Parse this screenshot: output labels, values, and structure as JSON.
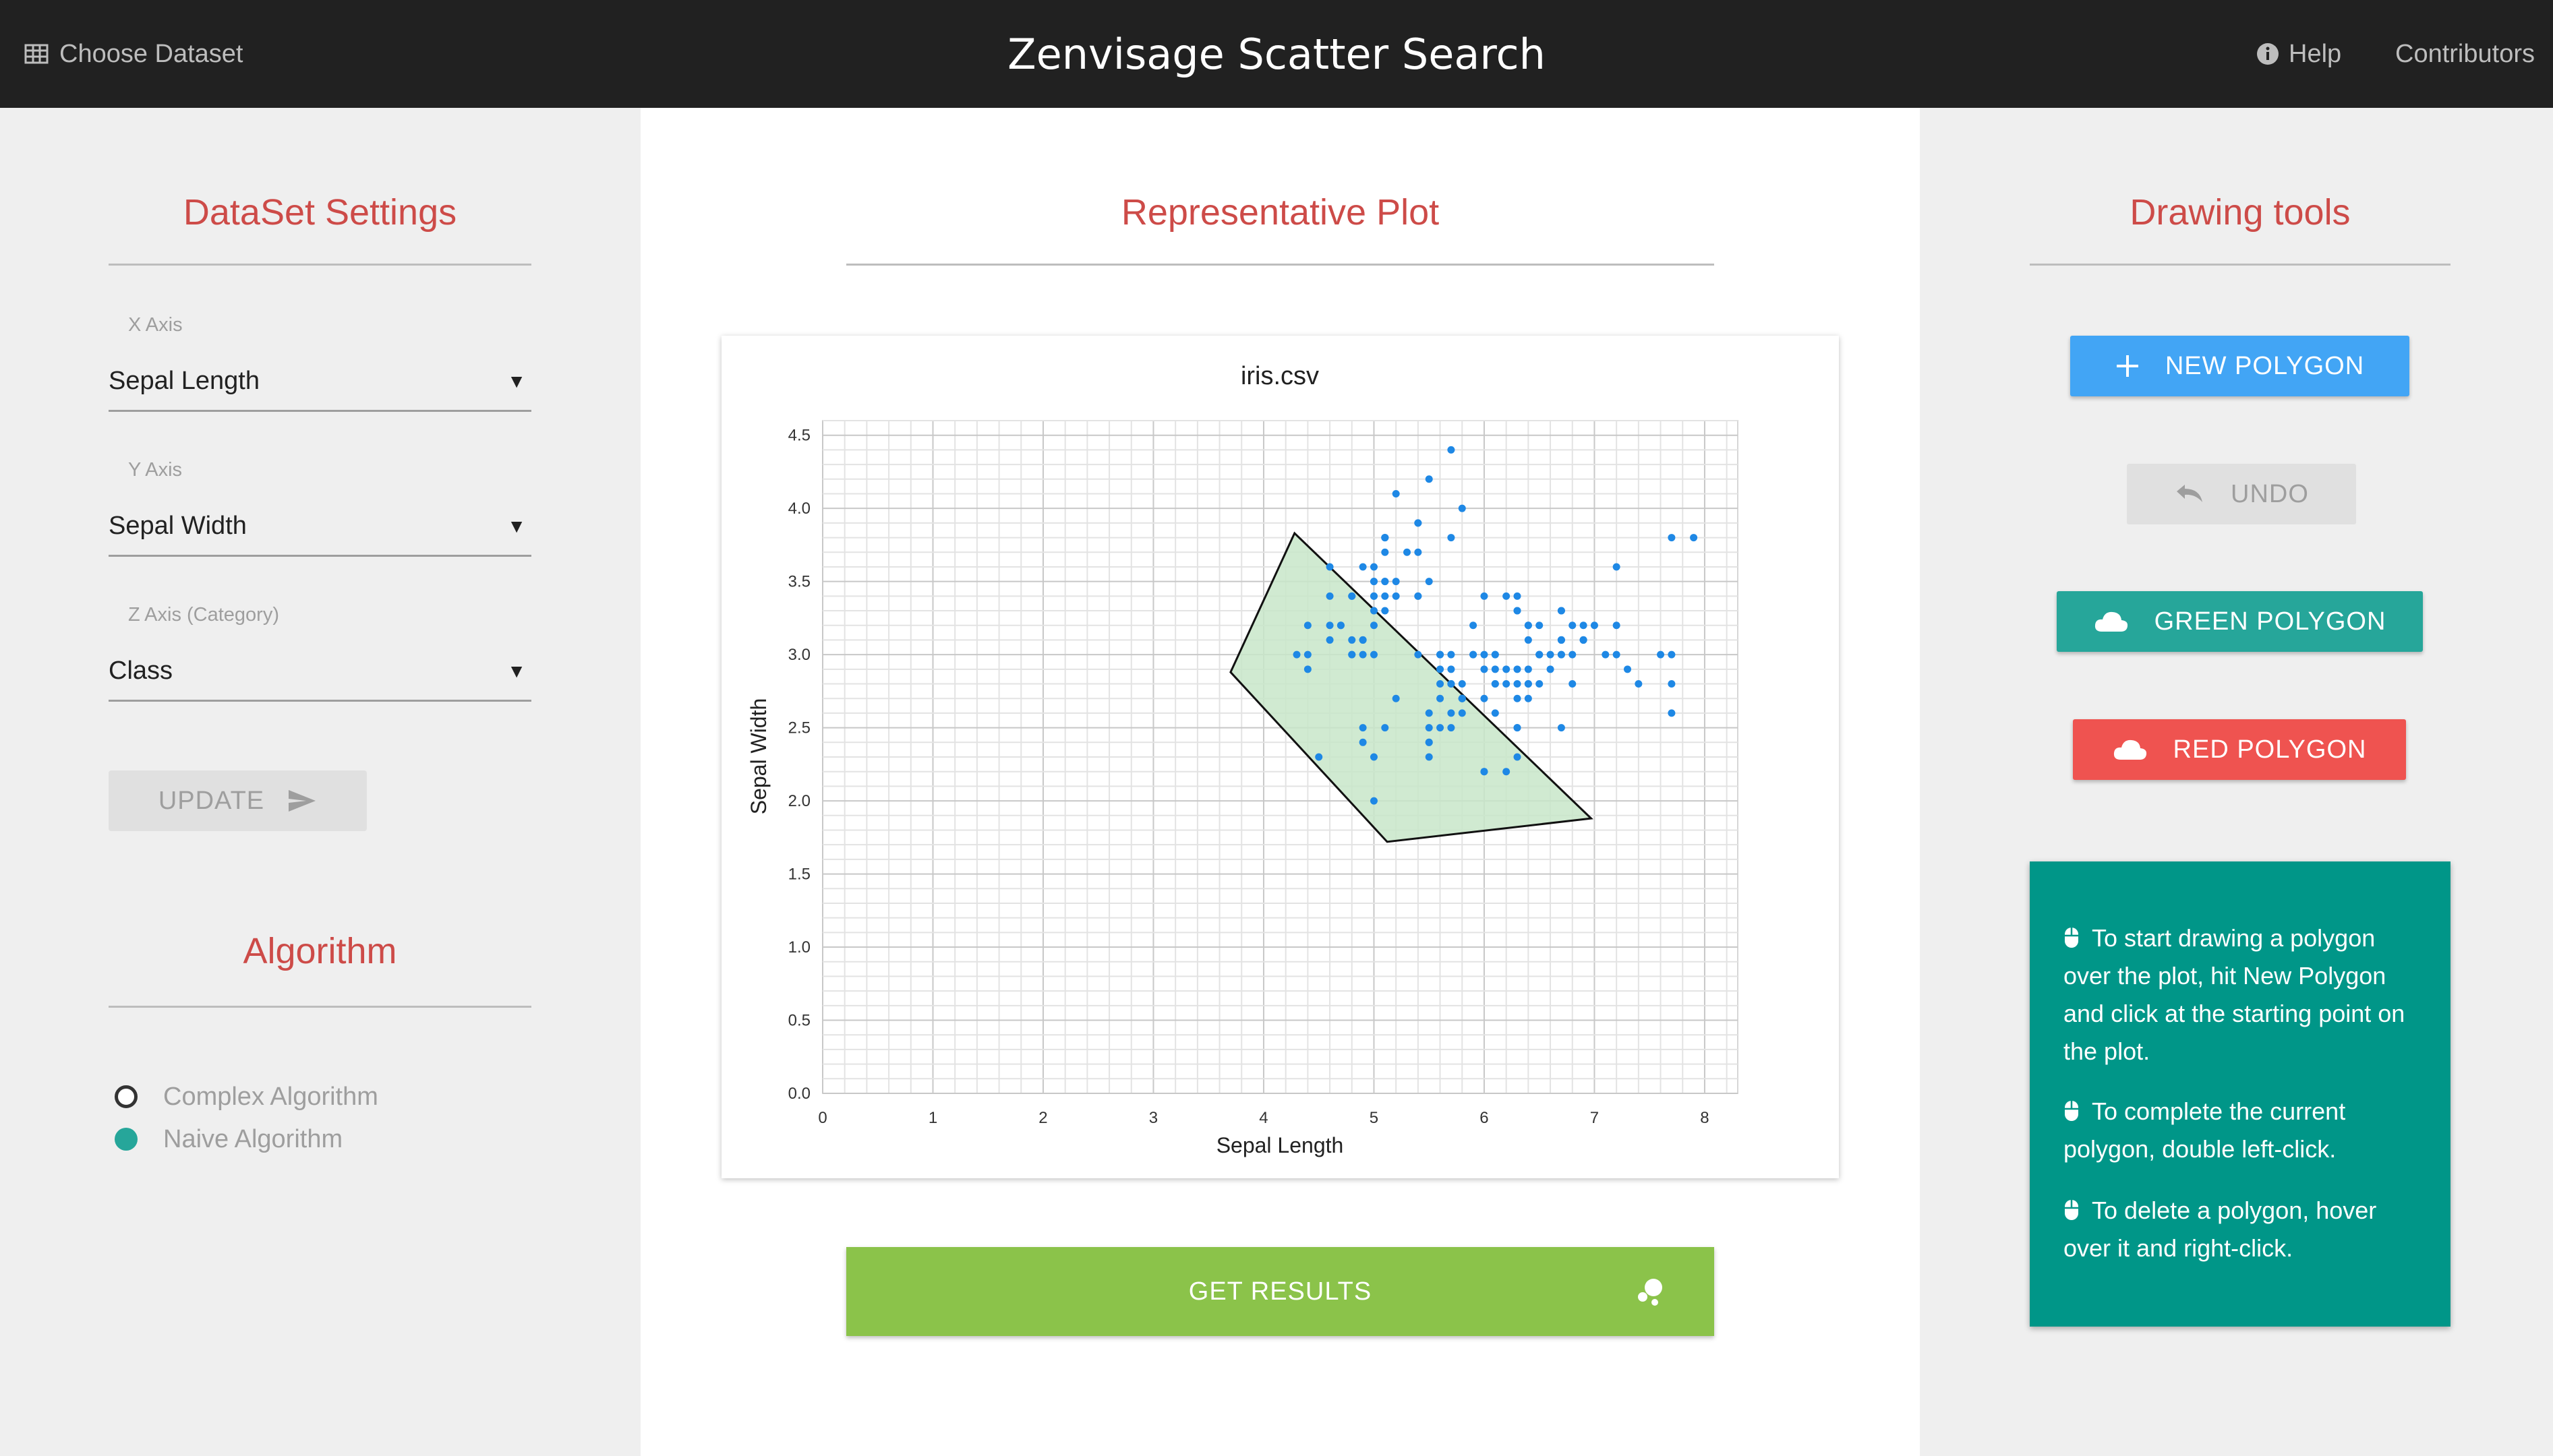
{
  "topbar": {
    "choose_dataset": "Choose Dataset",
    "title": "Zenvisage Scatter Search",
    "help": "Help",
    "contributors": "Contributors"
  },
  "dataset_settings": {
    "heading": "DataSet Settings",
    "x_axis_label": "X Axis",
    "x_axis_value": "Sepal Length",
    "y_axis_label": "Y Axis",
    "y_axis_value": "Sepal Width",
    "z_axis_label": "Z Axis (Category)",
    "z_axis_value": "Class",
    "update_label": "UPDATE"
  },
  "algorithm": {
    "heading": "Algorithm",
    "options": [
      {
        "label": "Complex Algorithm",
        "selected": false
      },
      {
        "label": "Naive Algorithm",
        "selected": true
      }
    ]
  },
  "center": {
    "heading": "Representative Plot",
    "get_results_label": "GET RESULTS"
  },
  "drawing_tools": {
    "heading": "Drawing tools",
    "new_polygon": "NEW POLYGON",
    "undo": "UNDO",
    "green_polygon": "GREEN POLYGON",
    "red_polygon": "RED POLYGON",
    "help": [
      "To start drawing a polygon over the plot, hit New Polygon and click at the starting point on the plot.",
      "To complete the current polygon, double left-click.",
      "To delete a polygon, hover over it and right-click."
    ]
  },
  "colors": {
    "heading": "#cd4b48",
    "topbar": "#212121",
    "point": "#1e88e5",
    "polygon_fill": "#c8e6c9",
    "new_polygon": "#42a5f5",
    "green_polygon": "#26a69a",
    "red_polygon": "#ef5350",
    "get_results": "#8bc34a",
    "help_box": "#009688"
  },
  "chart_data": {
    "type": "scatter",
    "title": "iris.csv",
    "xlabel": "Sepal Length",
    "ylabel": "Sepal Width",
    "xlim": [
      0,
      8.3
    ],
    "ylim": [
      0,
      4.6
    ],
    "xticks": [
      "0",
      "1",
      "2",
      "3",
      "4",
      "5",
      "6",
      "7",
      "8"
    ],
    "yticks": [
      "0.0",
      "0.5",
      "1.0",
      "1.5",
      "2.0",
      "2.5",
      "3.0",
      "3.5",
      "4.0",
      "4.5"
    ],
    "grid": true,
    "points": [
      [
        5.1,
        3.5
      ],
      [
        4.9,
        3.0
      ],
      [
        4.7,
        3.2
      ],
      [
        4.6,
        3.1
      ],
      [
        5.0,
        3.6
      ],
      [
        5.4,
        3.9
      ],
      [
        4.6,
        3.4
      ],
      [
        5.0,
        3.4
      ],
      [
        4.4,
        2.9
      ],
      [
        4.9,
        3.1
      ],
      [
        5.4,
        3.7
      ],
      [
        4.8,
        3.4
      ],
      [
        4.8,
        3.0
      ],
      [
        4.3,
        3.0
      ],
      [
        5.8,
        4.0
      ],
      [
        5.7,
        4.4
      ],
      [
        5.4,
        3.9
      ],
      [
        5.1,
        3.5
      ],
      [
        5.7,
        3.8
      ],
      [
        5.1,
        3.8
      ],
      [
        5.4,
        3.4
      ],
      [
        5.1,
        3.7
      ],
      [
        4.6,
        3.6
      ],
      [
        5.1,
        3.3
      ],
      [
        4.8,
        3.4
      ],
      [
        5.0,
        3.0
      ],
      [
        5.0,
        3.4
      ],
      [
        5.2,
        3.5
      ],
      [
        5.2,
        3.4
      ],
      [
        4.7,
        3.2
      ],
      [
        4.8,
        3.1
      ],
      [
        5.4,
        3.4
      ],
      [
        5.2,
        4.1
      ],
      [
        5.5,
        4.2
      ],
      [
        4.9,
        3.1
      ],
      [
        5.0,
        3.2
      ],
      [
        5.5,
        3.5
      ],
      [
        4.9,
        3.6
      ],
      [
        4.4,
        3.0
      ],
      [
        5.1,
        3.4
      ],
      [
        5.0,
        3.5
      ],
      [
        4.5,
        2.3
      ],
      [
        4.4,
        3.2
      ],
      [
        5.0,
        3.5
      ],
      [
        5.1,
        3.8
      ],
      [
        4.8,
        3.0
      ],
      [
        5.1,
        3.8
      ],
      [
        4.6,
        3.2
      ],
      [
        5.3,
        3.7
      ],
      [
        5.0,
        3.3
      ],
      [
        7.0,
        3.2
      ],
      [
        6.4,
        3.2
      ],
      [
        6.9,
        3.1
      ],
      [
        5.5,
        2.3
      ],
      [
        6.5,
        2.8
      ],
      [
        5.7,
        2.8
      ],
      [
        6.3,
        3.3
      ],
      [
        4.9,
        2.4
      ],
      [
        6.6,
        2.9
      ],
      [
        5.2,
        2.7
      ],
      [
        5.0,
        2.0
      ],
      [
        5.9,
        3.0
      ],
      [
        6.0,
        2.2
      ],
      [
        6.1,
        2.9
      ],
      [
        5.6,
        2.9
      ],
      [
        6.7,
        3.1
      ],
      [
        5.6,
        3.0
      ],
      [
        5.8,
        2.7
      ],
      [
        6.2,
        2.2
      ],
      [
        5.6,
        2.5
      ],
      [
        5.9,
        3.2
      ],
      [
        6.1,
        2.8
      ],
      [
        6.3,
        2.5
      ],
      [
        6.1,
        2.8
      ],
      [
        6.4,
        2.9
      ],
      [
        6.6,
        3.0
      ],
      [
        6.8,
        2.8
      ],
      [
        6.7,
        3.0
      ],
      [
        6.0,
        2.9
      ],
      [
        5.7,
        2.6
      ],
      [
        5.5,
        2.4
      ],
      [
        5.5,
        2.4
      ],
      [
        5.8,
        2.7
      ],
      [
        6.0,
        2.7
      ],
      [
        5.4,
        3.0
      ],
      [
        6.0,
        3.4
      ],
      [
        6.7,
        3.1
      ],
      [
        6.3,
        2.3
      ],
      [
        5.6,
        3.0
      ],
      [
        5.5,
        2.5
      ],
      [
        5.5,
        2.6
      ],
      [
        6.1,
        3.0
      ],
      [
        5.8,
        2.6
      ],
      [
        5.0,
        2.3
      ],
      [
        5.6,
        2.7
      ],
      [
        5.7,
        3.0
      ],
      [
        5.7,
        2.9
      ],
      [
        6.2,
        2.9
      ],
      [
        5.1,
        2.5
      ],
      [
        5.7,
        2.8
      ],
      [
        6.3,
        3.3
      ],
      [
        5.8,
        2.7
      ],
      [
        7.1,
        3.0
      ],
      [
        6.3,
        2.9
      ],
      [
        6.5,
        3.0
      ],
      [
        7.6,
        3.0
      ],
      [
        4.9,
        2.5
      ],
      [
        7.3,
        2.9
      ],
      [
        6.7,
        2.5
      ],
      [
        7.2,
        3.6
      ],
      [
        6.5,
        3.2
      ],
      [
        6.4,
        2.7
      ],
      [
        6.8,
        3.0
      ],
      [
        5.7,
        2.5
      ],
      [
        5.8,
        2.8
      ],
      [
        6.4,
        3.2
      ],
      [
        6.5,
        3.0
      ],
      [
        7.7,
        3.8
      ],
      [
        7.7,
        2.6
      ],
      [
        6.0,
        2.2
      ],
      [
        6.9,
        3.2
      ],
      [
        5.6,
        2.8
      ],
      [
        7.7,
        2.8
      ],
      [
        6.3,
        2.7
      ],
      [
        6.7,
        3.3
      ],
      [
        7.2,
        3.2
      ],
      [
        6.2,
        2.8
      ],
      [
        6.1,
        3.0
      ],
      [
        6.4,
        2.8
      ],
      [
        7.2,
        3.0
      ],
      [
        7.4,
        2.8
      ],
      [
        7.9,
        3.8
      ],
      [
        6.4,
        2.8
      ],
      [
        6.3,
        2.8
      ],
      [
        6.1,
        2.6
      ],
      [
        7.7,
        3.0
      ],
      [
        6.3,
        3.4
      ],
      [
        6.4,
        3.1
      ],
      [
        6.0,
        3.0
      ],
      [
        6.9,
        3.1
      ],
      [
        6.7,
        3.1
      ],
      [
        6.9,
        3.1
      ],
      [
        5.8,
        2.7
      ],
      [
        6.8,
        3.2
      ],
      [
        6.7,
        3.3
      ],
      [
        6.7,
        3.0
      ],
      [
        6.3,
        2.5
      ],
      [
        6.5,
        3.0
      ],
      [
        6.2,
        3.4
      ],
      [
        5.9,
        3.0
      ]
    ],
    "polygon": {
      "color": "green",
      "vertices": [
        [
          3.7,
          2.88
        ],
        [
          4.28,
          3.83
        ],
        [
          6.97,
          1.88
        ],
        [
          5.12,
          1.72
        ]
      ]
    }
  }
}
